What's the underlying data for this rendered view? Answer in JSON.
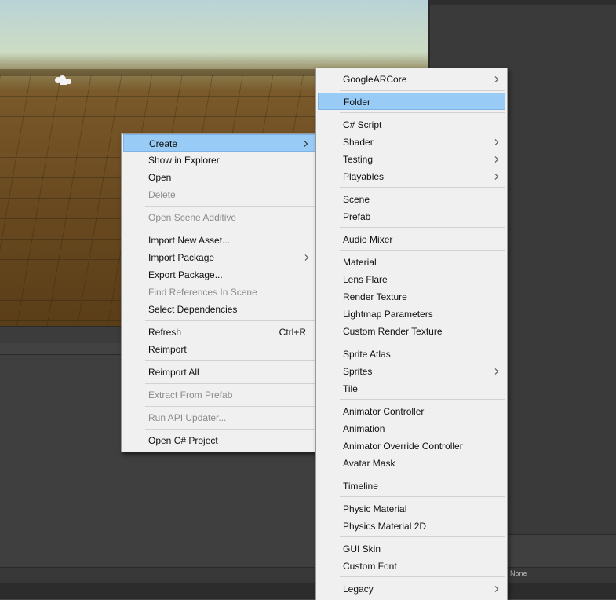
{
  "scene_panel": {
    "camera_icon": "camera-gizmo-icon"
  },
  "status_label": "None",
  "context_menu": {
    "items": [
      {
        "label": "Create",
        "submenu": true,
        "highlighted": true
      },
      {
        "label": "Show in Explorer"
      },
      {
        "label": "Open"
      },
      {
        "label": "Delete",
        "disabled": true
      },
      {
        "label": "Open Scene Additive",
        "disabled": true
      },
      {
        "label": "Import New Asset..."
      },
      {
        "label": "Import Package",
        "submenu": true
      },
      {
        "label": "Export Package..."
      },
      {
        "label": "Find References In Scene",
        "disabled": true
      },
      {
        "label": "Select Dependencies"
      },
      {
        "label": "Refresh",
        "shortcut": "Ctrl+R"
      },
      {
        "label": "Reimport"
      },
      {
        "label": "Reimport All"
      },
      {
        "label": "Extract From Prefab",
        "disabled": true
      },
      {
        "label": "Run API Updater...",
        "disabled": true
      },
      {
        "label": "Open C# Project"
      }
    ]
  },
  "create_submenu": {
    "items": [
      {
        "label": "GoogleARCore",
        "submenu": true
      },
      {
        "label": "Folder",
        "highlighted": true
      },
      {
        "label": "C# Script"
      },
      {
        "label": "Shader",
        "submenu": true
      },
      {
        "label": "Testing",
        "submenu": true
      },
      {
        "label": "Playables",
        "submenu": true
      },
      {
        "label": "Scene"
      },
      {
        "label": "Prefab"
      },
      {
        "label": "Audio Mixer"
      },
      {
        "label": "Material"
      },
      {
        "label": "Lens Flare"
      },
      {
        "label": "Render Texture"
      },
      {
        "label": "Lightmap Parameters"
      },
      {
        "label": "Custom Render Texture"
      },
      {
        "label": "Sprite Atlas"
      },
      {
        "label": "Sprites",
        "submenu": true
      },
      {
        "label": "Tile"
      },
      {
        "label": "Animator Controller"
      },
      {
        "label": "Animation"
      },
      {
        "label": "Animator Override Controller"
      },
      {
        "label": "Avatar Mask"
      },
      {
        "label": "Timeline"
      },
      {
        "label": "Physic Material"
      },
      {
        "label": "Physics Material 2D"
      },
      {
        "label": "GUI Skin"
      },
      {
        "label": "Custom Font"
      },
      {
        "label": "Legacy",
        "submenu": true
      }
    ]
  }
}
